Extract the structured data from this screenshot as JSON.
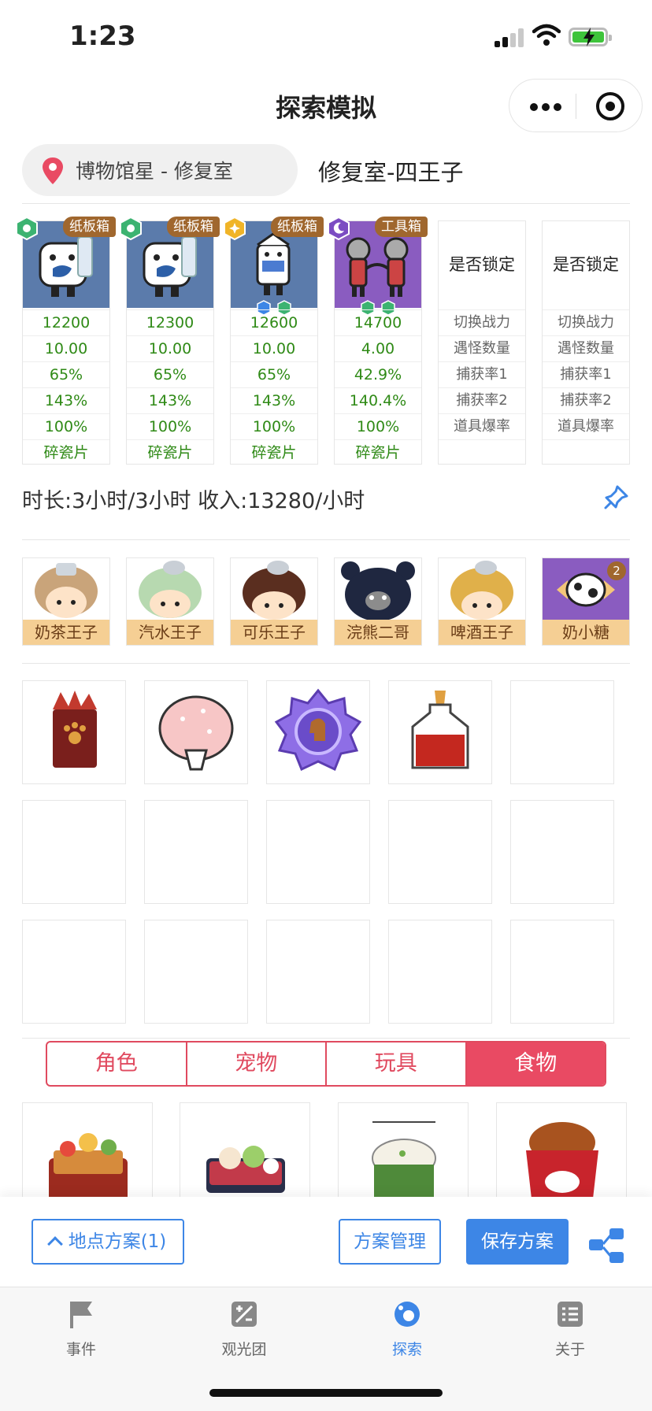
{
  "status_bar": {
    "time": "1:23"
  },
  "nav": {
    "title": "探索模拟"
  },
  "location": {
    "name": "博物馆星 - 修复室",
    "title": "修复室-四王子"
  },
  "team": [
    {
      "tag": "纸板箱",
      "badge_color": "#3cb371",
      "stats": [
        "12200",
        "10.00",
        "65%",
        "143%",
        "100%",
        "碎瓷片"
      ]
    },
    {
      "tag": "纸板箱",
      "badge_color": "#3cb371",
      "stats": [
        "12300",
        "10.00",
        "65%",
        "143%",
        "100%",
        "碎瓷片"
      ]
    },
    {
      "tag": "纸板箱",
      "badge_color": "#f0b428",
      "stats": [
        "12600",
        "10.00",
        "65%",
        "143%",
        "100%",
        "碎瓷片"
      ]
    },
    {
      "tag": "工具箱",
      "badge_color": "#7b4cc2",
      "stats": [
        "14700",
        "4.00",
        "42.9%",
        "140.4%",
        "100%",
        "碎瓷片"
      ]
    }
  ],
  "lock_columns": [
    {
      "header": "是否锁定",
      "rows": [
        "切换战力",
        "遇怪数量",
        "捕获率1",
        "捕获率2",
        "道具爆率"
      ]
    },
    {
      "header": "是否锁定",
      "rows": [
        "切换战力",
        "遇怪数量",
        "捕获率1",
        "捕获率2",
        "道具爆率"
      ]
    }
  ],
  "summary": {
    "duration_income": "时长:3小时/3小时 收入:13280/小时"
  },
  "characters": [
    {
      "name": "奶茶王子"
    },
    {
      "name": "汽水王子"
    },
    {
      "name": "可乐王子"
    },
    {
      "name": "浣熊二哥"
    },
    {
      "name": "啤酒王子"
    },
    {
      "name": "奶小糖",
      "count": "2"
    }
  ],
  "items": [
    {
      "icon": "red-paw-box-icon"
    },
    {
      "icon": "pink-mushroom-icon"
    },
    {
      "icon": "purple-medal-icon"
    },
    {
      "icon": "red-potion-icon"
    }
  ],
  "category_tabs": {
    "tabs": [
      "角色",
      "宠物",
      "玩具",
      "食物"
    ],
    "active": "食物"
  },
  "foods": [
    {
      "icon": "bento-box-icon"
    },
    {
      "icon": "sushi-box-icon"
    },
    {
      "icon": "matcha-rice-icon"
    },
    {
      "icon": "fried-chicken-bucket-icon"
    }
  ],
  "actions": {
    "location_plan": "地点方案(1)",
    "manage": "方案管理",
    "save": "保存方案"
  },
  "tabbar": [
    {
      "label": "事件",
      "icon": "flag-icon"
    },
    {
      "label": "观光团",
      "icon": "calculator-icon"
    },
    {
      "label": "探索",
      "icon": "explore-icon",
      "active": true
    },
    {
      "label": "关于",
      "icon": "list-icon"
    }
  ],
  "colors": {
    "accent_blue": "#3d86e6",
    "accent_red": "#e94a63",
    "stat_green": "#2f8a16",
    "tag_brown": "#a0672e"
  }
}
